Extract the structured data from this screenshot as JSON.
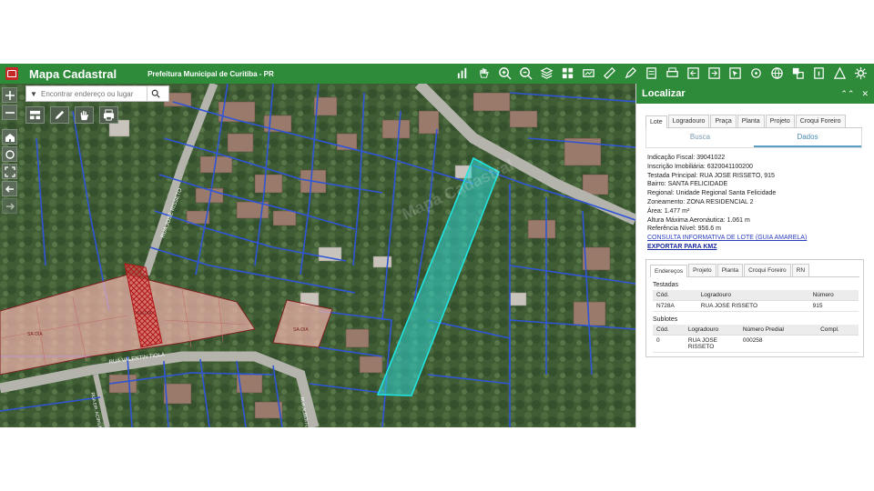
{
  "header": {
    "title": "Mapa Cadastral",
    "subtitle": "Prefeitura Municipal de Curitiba - PR",
    "tools": [
      "legend-icon",
      "pan-hand-icon",
      "zoom-in-icon",
      "zoom-out-icon",
      "layers-icon",
      "grid-icon",
      "basemap-icon",
      "ruler-icon",
      "draw-icon",
      "measure-icon",
      "print-icon",
      "import-icon",
      "export-icon",
      "select-icon",
      "target-icon",
      "globe-icon",
      "images-icon",
      "info-icon",
      "warning-icon",
      "settings-icon"
    ]
  },
  "map": {
    "search_placeholder": "Encontrar endereço ou lugar",
    "street_labels": [
      "RUA JOSE RISSETO",
      "RUA VALENTIN TIOLA",
      "RUA DR. ACIRIUDES COLTO",
      "RUA ALBERTO VILELA"
    ],
    "lot_labels": [
      "SA-DIA",
      "SA-DIA",
      "SA-DIA"
    ],
    "watermark": "Mapa Cadastral"
  },
  "panel": {
    "title": "Localizar",
    "tabs": [
      "Lote",
      "Logradouro",
      "Praça",
      "Planta",
      "Projeto",
      "Croqui Foreiro"
    ],
    "subtabs": [
      "Busca",
      "Dados"
    ],
    "details": [
      {
        "k": "Indicação Fiscal:",
        "v": "39041022"
      },
      {
        "k": "Inscrição Imobiliária:",
        "v": "63200411002​00"
      },
      {
        "k": "Testada Principal:",
        "v": "RUA JOSE RISSETO, 915"
      },
      {
        "k": "Bairro:",
        "v": "SANTA FELICIDADE"
      },
      {
        "k": "Regional:",
        "v": "Unidade Regional Santa Felicidade"
      },
      {
        "k": "Zoneamento:",
        "v": "ZONA RESIDENCIAL 2"
      },
      {
        "k": "Área:",
        "v": "1.477 m²"
      },
      {
        "k": "Altura Máxima Aeronáutica:",
        "v": "1.061 m"
      },
      {
        "k": "Referência Nível:",
        "v": "956.6 m"
      }
    ],
    "link_consulta": "CONSULTA INFORMATIVA DE LOTE (GUIA AMARELA)",
    "link_exportar": "EXPORTAR PARA KMZ",
    "inner_tabs": [
      "Endereços",
      "Projeto",
      "Planta",
      "Croqui Foreiro",
      "RN"
    ],
    "testadas": {
      "title": "Testadas",
      "headers": [
        "Cód.",
        "Logradouro",
        "Número"
      ],
      "rows": [
        [
          "N728A",
          "RUA JOSE RISSETO",
          "915"
        ]
      ]
    },
    "sublotes": {
      "title": "Sublotes",
      "headers": [
        "Cód.",
        "Logradouro",
        "Número Predial",
        "Compl."
      ],
      "rows": [
        [
          "0",
          "RUA JOSE RISSETO",
          "000258",
          ""
        ]
      ]
    }
  },
  "colors": {
    "brand": "#2e8b3a",
    "highlight_lot": "#2fd6d2",
    "link": "#2a3fbf"
  }
}
